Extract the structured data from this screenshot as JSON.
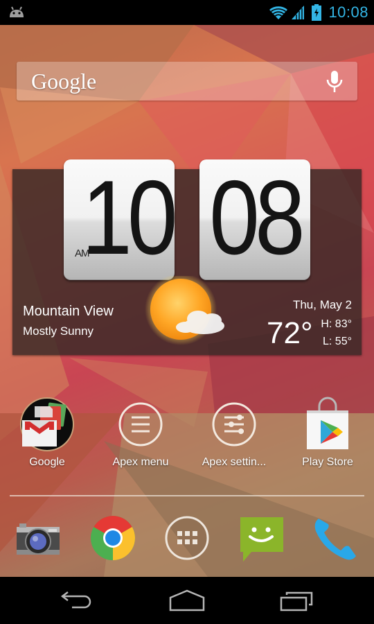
{
  "status_bar": {
    "time": "10:08",
    "icons": [
      "android-debug-icon",
      "wifi-icon",
      "cell-signal-icon",
      "battery-charging-icon"
    ],
    "accent_color": "#33b5e5"
  },
  "search": {
    "logo_text": "Google",
    "voice_icon": "mic-icon"
  },
  "clock_widget": {
    "hour": "10",
    "minute": "08",
    "meridiem": "AM",
    "city": "Mountain View",
    "condition": "Mostly Sunny",
    "condition_icon": "sun-cloud-icon",
    "date": "Thu, May 2",
    "temperature": "72°",
    "high": "H:  83°",
    "low": "L:  55°"
  },
  "apps": [
    {
      "label": "Google",
      "icon": "google-folder-icon"
    },
    {
      "label": "Apex menu",
      "icon": "apex-menu-icon"
    },
    {
      "label": "Apex settin...",
      "icon": "apex-settings-icon"
    },
    {
      "label": "Play Store",
      "icon": "play-store-icon"
    }
  ],
  "dock": [
    {
      "name": "Camera",
      "icon": "camera-icon"
    },
    {
      "name": "Chrome",
      "icon": "chrome-icon"
    },
    {
      "name": "All apps",
      "icon": "app-drawer-icon"
    },
    {
      "name": "Messaging",
      "icon": "messaging-icon"
    },
    {
      "name": "Phone",
      "icon": "phone-icon"
    }
  ],
  "nav_bar": {
    "buttons": [
      "back",
      "home",
      "recents"
    ]
  }
}
